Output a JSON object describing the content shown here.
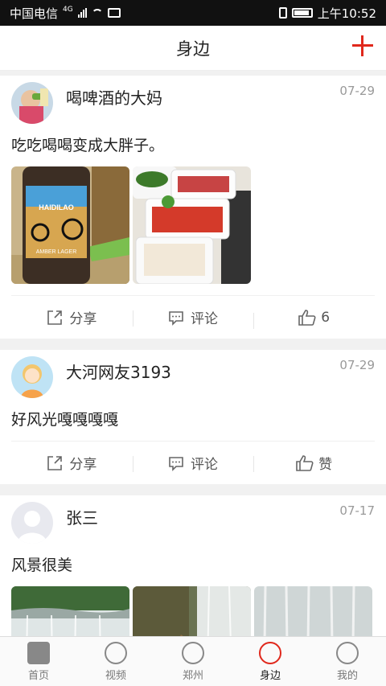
{
  "status_bar": {
    "carrier": "中国电信",
    "network": "4G",
    "time": "上午10:52"
  },
  "header": {
    "title": "身边",
    "add_icon": "plus-icon",
    "accent": "#e0281c"
  },
  "posts": [
    {
      "user": "喝啤酒的大妈",
      "date": "07-29",
      "text": "吃吃喝喝变成大胖子。",
      "share": "分享",
      "comment": "评论",
      "like": "6",
      "bottle_label": "HAIDILAO",
      "bottle_sub": "AMBER LAGER"
    },
    {
      "user": "大河网友3193",
      "date": "07-29",
      "text": "好风光嘎嘎嘎嘎",
      "share": "分享",
      "comment": "评论",
      "like": "赞"
    },
    {
      "user": "张三",
      "date": "07-17",
      "text": "风景很美"
    }
  ],
  "tabs": [
    {
      "label": "首页",
      "icon": "home-icon"
    },
    {
      "label": "视频",
      "icon": "video-icon"
    },
    {
      "label": "郑州",
      "icon": "location-icon"
    },
    {
      "label": "身边",
      "icon": "compass-icon",
      "active": true
    },
    {
      "label": "我的",
      "icon": "user-icon"
    }
  ]
}
